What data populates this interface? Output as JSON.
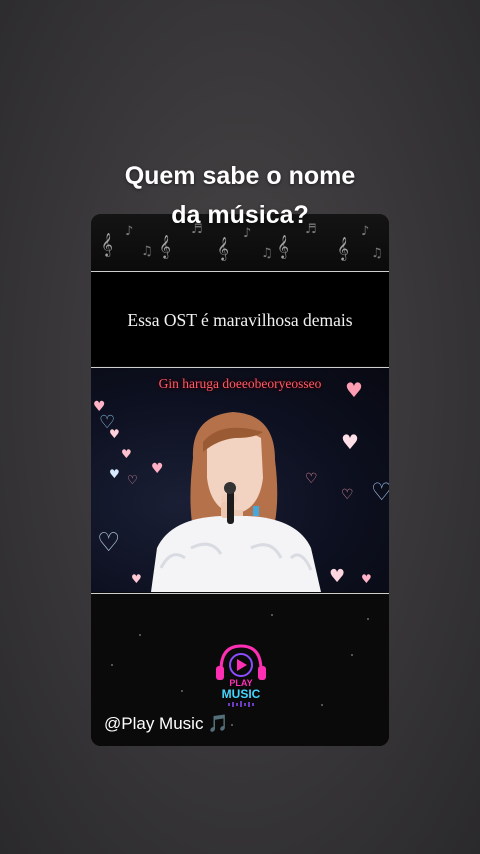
{
  "story": {
    "title_line1": "Quem sabe o nome",
    "title_line2": "da música?"
  },
  "video_card": {
    "caption": "Essa OST é maravilhosa demais",
    "lyric": "Gin haruga doeeobeoryeosseo",
    "handle": "@Play Music",
    "handle_icon": "🎵",
    "logo": {
      "line1": "PLAY",
      "line2": "MUSIC"
    }
  },
  "colors": {
    "lyric": "#ff5a6a",
    "logo_pink": "#ff2fb4",
    "logo_cyan": "#44d6ff",
    "logo_purple": "#8a4dff"
  }
}
